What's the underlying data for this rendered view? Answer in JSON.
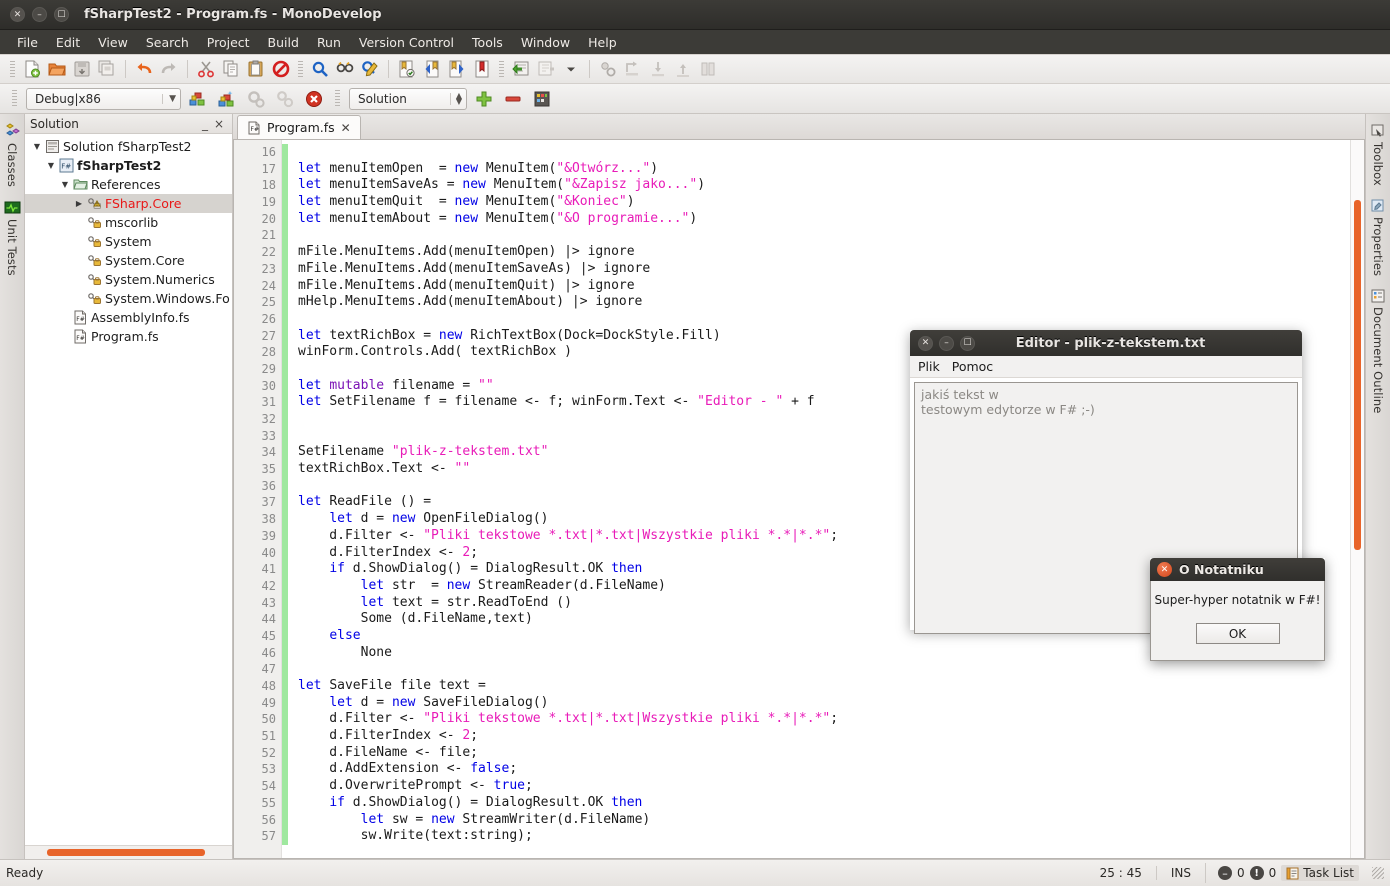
{
  "window": {
    "title": "fSharpTest2 - Program.fs - MonoDevelop"
  },
  "menubar": {
    "items": [
      "File",
      "Edit",
      "View",
      "Search",
      "Project",
      "Build",
      "Run",
      "Version Control",
      "Tools",
      "Window",
      "Help"
    ]
  },
  "toolbar2": {
    "configuration": "Debug|x86",
    "scope": "Solution"
  },
  "left_dock": {
    "items": [
      {
        "label": "Classes",
        "icon": "classes-icon"
      },
      {
        "label": "Unit Tests",
        "icon": "unit-tests-icon"
      }
    ]
  },
  "right_dock": {
    "items": [
      {
        "label": "Toolbox",
        "icon": "toolbox-icon"
      },
      {
        "label": "Properties",
        "icon": "properties-icon"
      },
      {
        "label": "Document Outline",
        "icon": "document-outline-icon"
      }
    ]
  },
  "solution_pad": {
    "title": "Solution",
    "minimize": "_",
    "close": "×",
    "tree": [
      {
        "label": "Solution fSharpTest2",
        "indent": 0,
        "twisty": "▼",
        "icon": "solution-icon",
        "bold": false,
        "selected": false,
        "color": ""
      },
      {
        "label": "fSharpTest2",
        "indent": 1,
        "twisty": "▼",
        "icon": "fsproj-icon",
        "bold": true,
        "selected": false,
        "color": ""
      },
      {
        "label": "References",
        "indent": 2,
        "twisty": "▼",
        "icon": "folder-icon",
        "bold": false,
        "selected": false,
        "color": ""
      },
      {
        "label": "FSharp.Core",
        "indent": 3,
        "twisty": "▶",
        "icon": "reference-warning-icon",
        "bold": false,
        "selected": true,
        "color": "#e81818"
      },
      {
        "label": "mscorlib",
        "indent": 3,
        "twisty": "",
        "icon": "reference-icon",
        "bold": false,
        "selected": false,
        "color": ""
      },
      {
        "label": "System",
        "indent": 3,
        "twisty": "",
        "icon": "reference-icon",
        "bold": false,
        "selected": false,
        "color": ""
      },
      {
        "label": "System.Core",
        "indent": 3,
        "twisty": "",
        "icon": "reference-icon",
        "bold": false,
        "selected": false,
        "color": ""
      },
      {
        "label": "System.Numerics",
        "indent": 3,
        "twisty": "",
        "icon": "reference-icon",
        "bold": false,
        "selected": false,
        "color": ""
      },
      {
        "label": "System.Windows.Fo",
        "indent": 3,
        "twisty": "",
        "icon": "reference-icon",
        "bold": false,
        "selected": false,
        "color": ""
      },
      {
        "label": "AssemblyInfo.fs",
        "indent": 2,
        "twisty": "",
        "icon": "fsfile-icon",
        "bold": false,
        "selected": false,
        "color": ""
      },
      {
        "label": "Program.fs",
        "indent": 2,
        "twisty": "",
        "icon": "fsfile-icon",
        "bold": false,
        "selected": false,
        "color": ""
      }
    ]
  },
  "tabs": [
    {
      "label": "Program.fs",
      "close": "✕",
      "icon": "fsfile-icon",
      "active": true
    }
  ],
  "editor": {
    "first_line": 16,
    "lines": [
      {
        "n": 16,
        "tokens": []
      },
      {
        "n": 17,
        "tokens": [
          {
            "t": "let ",
            "c": "k"
          },
          {
            "t": "menuItemOpen  = ",
            "c": ""
          },
          {
            "t": "new ",
            "c": "k"
          },
          {
            "t": "MenuItem(",
            "c": ""
          },
          {
            "t": "\"&Otwórz...\"",
            "c": "s"
          },
          {
            "t": ")",
            "c": ""
          }
        ]
      },
      {
        "n": 18,
        "tokens": [
          {
            "t": "let ",
            "c": "k"
          },
          {
            "t": "menuItemSaveAs = ",
            "c": ""
          },
          {
            "t": "new ",
            "c": "k"
          },
          {
            "t": "MenuItem(",
            "c": ""
          },
          {
            "t": "\"&Zapisz jako...\"",
            "c": "s"
          },
          {
            "t": ")",
            "c": ""
          }
        ]
      },
      {
        "n": 19,
        "tokens": [
          {
            "t": "let ",
            "c": "k"
          },
          {
            "t": "menuItemQuit  = ",
            "c": ""
          },
          {
            "t": "new ",
            "c": "k"
          },
          {
            "t": "MenuItem(",
            "c": ""
          },
          {
            "t": "\"&Koniec\"",
            "c": "s"
          },
          {
            "t": ")",
            "c": ""
          }
        ]
      },
      {
        "n": 20,
        "tokens": [
          {
            "t": "let ",
            "c": "k"
          },
          {
            "t": "menuItemAbout = ",
            "c": ""
          },
          {
            "t": "new ",
            "c": "k"
          },
          {
            "t": "MenuItem(",
            "c": ""
          },
          {
            "t": "\"&O programie...\"",
            "c": "s"
          },
          {
            "t": ")",
            "c": ""
          }
        ]
      },
      {
        "n": 21,
        "tokens": []
      },
      {
        "n": 22,
        "tokens": [
          {
            "t": "mFile.MenuItems.Add(menuItemOpen) |> ignore",
            "c": ""
          }
        ]
      },
      {
        "n": 23,
        "tokens": [
          {
            "t": "mFile.MenuItems.Add(menuItemSaveAs) |> ignore",
            "c": ""
          }
        ]
      },
      {
        "n": 24,
        "tokens": [
          {
            "t": "mFile.MenuItems.Add(menuItemQuit) |> ignore",
            "c": ""
          }
        ]
      },
      {
        "n": 25,
        "tokens": [
          {
            "t": "mHelp.MenuItems.Add(menuItemAbout) |> ignore",
            "c": ""
          }
        ]
      },
      {
        "n": 26,
        "tokens": []
      },
      {
        "n": 27,
        "tokens": [
          {
            "t": "let ",
            "c": "k"
          },
          {
            "t": "textRichBox = ",
            "c": ""
          },
          {
            "t": "new ",
            "c": "k"
          },
          {
            "t": "RichTextBox(Dock=DockStyle.Fill)",
            "c": ""
          }
        ]
      },
      {
        "n": 28,
        "tokens": [
          {
            "t": "winForm.Controls.Add( textRichBox )",
            "c": ""
          }
        ]
      },
      {
        "n": 29,
        "tokens": []
      },
      {
        "n": 30,
        "tokens": [
          {
            "t": "let ",
            "c": "k"
          },
          {
            "t": "mutable ",
            "c": "kw"
          },
          {
            "t": "filename = ",
            "c": ""
          },
          {
            "t": "\"\"",
            "c": "s"
          }
        ]
      },
      {
        "n": 31,
        "tokens": [
          {
            "t": "let ",
            "c": "k"
          },
          {
            "t": "SetFilename f = filename <- f; winForm.Text <- ",
            "c": ""
          },
          {
            "t": "\"Editor - \"",
            "c": "s"
          },
          {
            "t": " + f",
            "c": ""
          }
        ]
      },
      {
        "n": 32,
        "tokens": []
      },
      {
        "n": 33,
        "tokens": []
      },
      {
        "n": 34,
        "tokens": [
          {
            "t": "SetFilename ",
            "c": ""
          },
          {
            "t": "\"plik-z-tekstem.txt\"",
            "c": "s"
          }
        ]
      },
      {
        "n": 35,
        "tokens": [
          {
            "t": "textRichBox.Text <- ",
            "c": ""
          },
          {
            "t": "\"\"",
            "c": "s"
          }
        ]
      },
      {
        "n": 36,
        "tokens": []
      },
      {
        "n": 37,
        "tokens": [
          {
            "t": "let ",
            "c": "k"
          },
          {
            "t": "ReadFile () =",
            "c": ""
          }
        ]
      },
      {
        "n": 38,
        "tokens": [
          {
            "t": "    ",
            "c": ""
          },
          {
            "t": "let ",
            "c": "k"
          },
          {
            "t": "d = ",
            "c": ""
          },
          {
            "t": "new ",
            "c": "k"
          },
          {
            "t": "OpenFileDialog()",
            "c": ""
          }
        ]
      },
      {
        "n": 39,
        "tokens": [
          {
            "t": "    d.Filter <- ",
            "c": ""
          },
          {
            "t": "\"Pliki tekstowe *.txt|*.txt|Wszystkie pliki *.*|*.*\"",
            "c": "s"
          },
          {
            "t": ";",
            "c": ""
          }
        ]
      },
      {
        "n": 40,
        "tokens": [
          {
            "t": "    d.FilterIndex <- ",
            "c": ""
          },
          {
            "t": "2",
            "c": "n"
          },
          {
            "t": ";",
            "c": ""
          }
        ]
      },
      {
        "n": 41,
        "tokens": [
          {
            "t": "    ",
            "c": ""
          },
          {
            "t": "if ",
            "c": "k"
          },
          {
            "t": "d.ShowDialog() = DialogResult.OK ",
            "c": ""
          },
          {
            "t": "then",
            "c": "k"
          }
        ]
      },
      {
        "n": 42,
        "tokens": [
          {
            "t": "        ",
            "c": ""
          },
          {
            "t": "let ",
            "c": "k"
          },
          {
            "t": "str  = ",
            "c": ""
          },
          {
            "t": "new ",
            "c": "k"
          },
          {
            "t": "StreamReader(d.FileName)",
            "c": ""
          }
        ]
      },
      {
        "n": 43,
        "tokens": [
          {
            "t": "        ",
            "c": ""
          },
          {
            "t": "let ",
            "c": "k"
          },
          {
            "t": "text = str.ReadToEnd ()",
            "c": ""
          }
        ]
      },
      {
        "n": 44,
        "tokens": [
          {
            "t": "        Some (d.FileName,text)",
            "c": ""
          }
        ]
      },
      {
        "n": 45,
        "tokens": [
          {
            "t": "    ",
            "c": ""
          },
          {
            "t": "else",
            "c": "k"
          }
        ]
      },
      {
        "n": 46,
        "tokens": [
          {
            "t": "        None",
            "c": ""
          }
        ]
      },
      {
        "n": 47,
        "tokens": []
      },
      {
        "n": 48,
        "tokens": [
          {
            "t": "let ",
            "c": "k"
          },
          {
            "t": "SaveFile file text =",
            "c": ""
          }
        ]
      },
      {
        "n": 49,
        "tokens": [
          {
            "t": "    ",
            "c": ""
          },
          {
            "t": "let ",
            "c": "k"
          },
          {
            "t": "d = ",
            "c": ""
          },
          {
            "t": "new ",
            "c": "k"
          },
          {
            "t": "SaveFileDialog()",
            "c": ""
          }
        ]
      },
      {
        "n": 50,
        "tokens": [
          {
            "t": "    d.Filter <- ",
            "c": ""
          },
          {
            "t": "\"Pliki tekstowe *.txt|*.txt|Wszystkie pliki *.*|*.*\"",
            "c": "s"
          },
          {
            "t": ";",
            "c": ""
          }
        ]
      },
      {
        "n": 51,
        "tokens": [
          {
            "t": "    d.FilterIndex <- ",
            "c": ""
          },
          {
            "t": "2",
            "c": "n"
          },
          {
            "t": ";",
            "c": ""
          }
        ]
      },
      {
        "n": 52,
        "tokens": [
          {
            "t": "    d.FileName <- file;",
            "c": ""
          }
        ]
      },
      {
        "n": 53,
        "tokens": [
          {
            "t": "    d.AddExtension <- ",
            "c": ""
          },
          {
            "t": "false",
            "c": "k"
          },
          {
            "t": ";",
            "c": ""
          }
        ]
      },
      {
        "n": 54,
        "tokens": [
          {
            "t": "    d.OverwritePrompt <- ",
            "c": ""
          },
          {
            "t": "true",
            "c": "k"
          },
          {
            "t": ";",
            "c": ""
          }
        ]
      },
      {
        "n": 55,
        "tokens": [
          {
            "t": "    ",
            "c": ""
          },
          {
            "t": "if ",
            "c": "k"
          },
          {
            "t": "d.ShowDialog() = DialogResult.OK ",
            "c": ""
          },
          {
            "t": "then",
            "c": "k"
          }
        ]
      },
      {
        "n": 56,
        "tokens": [
          {
            "t": "        ",
            "c": ""
          },
          {
            "t": "let ",
            "c": "k"
          },
          {
            "t": "sw = ",
            "c": ""
          },
          {
            "t": "new ",
            "c": "k"
          },
          {
            "t": "StreamWriter(d.FileName)",
            "c": ""
          }
        ]
      },
      {
        "n": 57,
        "tokens": [
          {
            "t": "        sw.Write(text:string);",
            "c": ""
          }
        ]
      }
    ]
  },
  "statusbar": {
    "message": "Ready",
    "position": "25 : 45",
    "mode": "INS",
    "errors": "0",
    "warnings": "0",
    "tasklist": "Task List"
  },
  "editor_window": {
    "title": "Editor - plik-z-tekstem.txt",
    "menu": [
      "Plik",
      "Pomoc"
    ],
    "text": "jakiś tekst w\ntestowym edytorze w F# ;-)"
  },
  "about_dialog": {
    "title": "O Notatniku",
    "message": "Super-hyper notatnik w F#!",
    "ok": "OK"
  },
  "colors": {
    "accent_orange": "#e8642a",
    "error_red": "#e81818",
    "string_pink": "#e81bb8",
    "keyword_blue": "#0000e6",
    "modbar_green": "#9fe89f",
    "titlebar_dark": "#3c3b37"
  }
}
